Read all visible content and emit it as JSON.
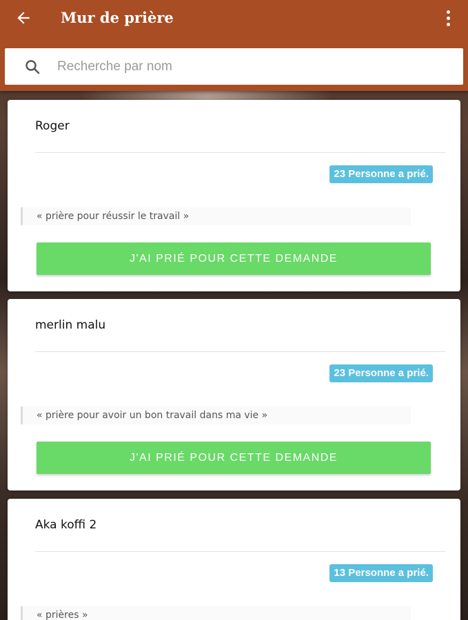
{
  "header": {
    "title": "Mur de prière",
    "back_icon": "arrow-left-icon",
    "menu_icon": "more-vertical-icon",
    "background_color": "#a84d24"
  },
  "search": {
    "placeholder": "Recherche par nom",
    "value": "",
    "icon": "search-icon"
  },
  "prayers": [
    {
      "name": "Roger",
      "count_label": "23 Personne a prié.",
      "request": "« prière pour réussir le travail »",
      "button_label": "J'AI PRIÉ POUR CETTE DEMANDE"
    },
    {
      "name": "merlin malu",
      "count_label": "23 Personne a prié.",
      "request": "« prière pour avoir un bon travail dans ma vie »",
      "button_label": "J'AI PRIÉ POUR CETTE DEMANDE"
    },
    {
      "name": "Aka koffi 2",
      "count_label": "13 Personne a prié.",
      "request": "« prières »",
      "button_label": ""
    }
  ],
  "colors": {
    "badge": "#5bc0de",
    "button": "#69d968"
  }
}
